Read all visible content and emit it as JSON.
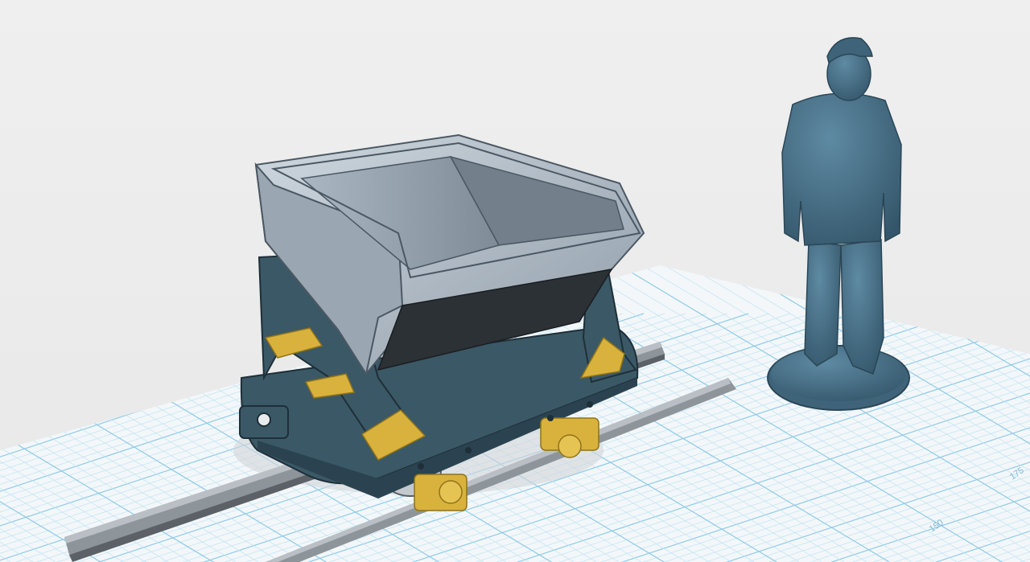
{
  "viewport": {
    "background_color": "#ececec",
    "grid_line_color": "#bfe3f3",
    "grid_major_color": "#8fcbe8"
  },
  "grid": {
    "ruler_labels": [
      "150",
      "175"
    ]
  },
  "scene_objects": [
    {
      "name": "mine-cart",
      "type": "3d-model",
      "colors": {
        "tub": "#b9c4cf",
        "frame": "#3b5866",
        "brackets": "#d9b23d",
        "wheels": "#c4c9cf"
      }
    },
    {
      "name": "rail-track",
      "type": "3d-model",
      "colors": {
        "rail": "#8d949a"
      }
    },
    {
      "name": "worker-figure",
      "type": "3d-model",
      "colors": {
        "body": "#4a7189"
      }
    }
  ]
}
